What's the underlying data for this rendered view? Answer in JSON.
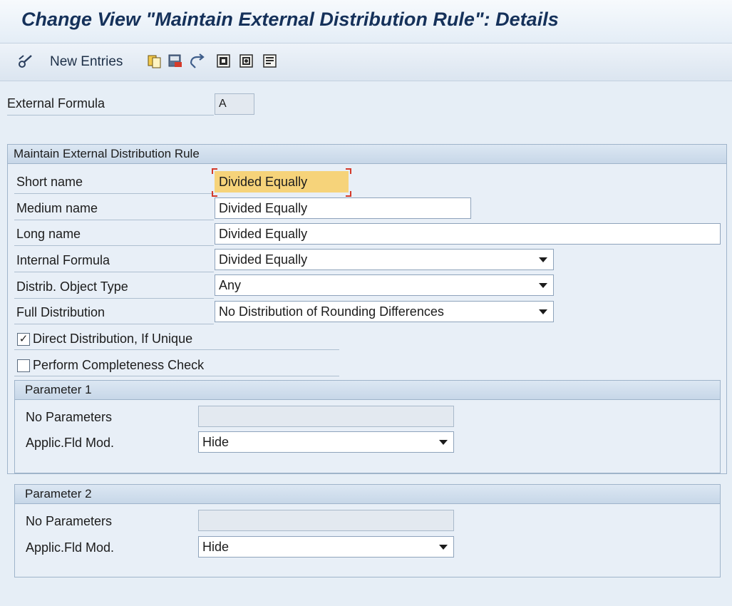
{
  "window": {
    "title": "Change View \"Maintain External Distribution Rule\": Details"
  },
  "toolbar": {
    "new_entries_label": "New Entries",
    "icons": [
      "edit-glasses-icon",
      "copy-icon",
      "delete-icon",
      "undo-icon",
      "previous-entry-icon",
      "next-entry-icon",
      "other-entry-icon"
    ]
  },
  "header": {
    "external_formula_label": "External Formula",
    "external_formula_value": "A"
  },
  "main_group": {
    "title": "Maintain External Distribution Rule",
    "short_name_label": "Short name",
    "short_name_value": "Divided Equally",
    "medium_name_label": "Medium name",
    "medium_name_value": "Divided Equally",
    "long_name_label": "Long name",
    "long_name_value": "Divided Equally",
    "internal_formula_label": "Internal Formula",
    "internal_formula_value": "Divided Equally",
    "distrib_object_type_label": "Distrib. Object Type",
    "distrib_object_type_value": "Any",
    "full_distribution_label": "Full Distribution",
    "full_distribution_value": "No Distribution of Rounding Differences",
    "direct_distribution_label": "Direct Distribution, If Unique",
    "direct_distribution_checked": true,
    "completeness_check_label": "Perform Completeness Check",
    "completeness_check_checked": false
  },
  "parameter1": {
    "title": "Parameter 1",
    "no_parameters_label": "No Parameters",
    "no_parameters_value": "",
    "applic_fld_mod_label": "Applic.Fld Mod.",
    "applic_fld_mod_value": "Hide"
  },
  "parameter2": {
    "title": "Parameter 2",
    "no_parameters_label": "No Parameters",
    "no_parameters_value": "",
    "applic_fld_mod_label": "Applic.Fld Mod.",
    "applic_fld_mod_value": "Hide"
  },
  "colors": {
    "title_text": "#15315a",
    "background": "#e6eef6",
    "focus_highlight": "#f6d37a",
    "focus_corner": "#d43a2a"
  }
}
